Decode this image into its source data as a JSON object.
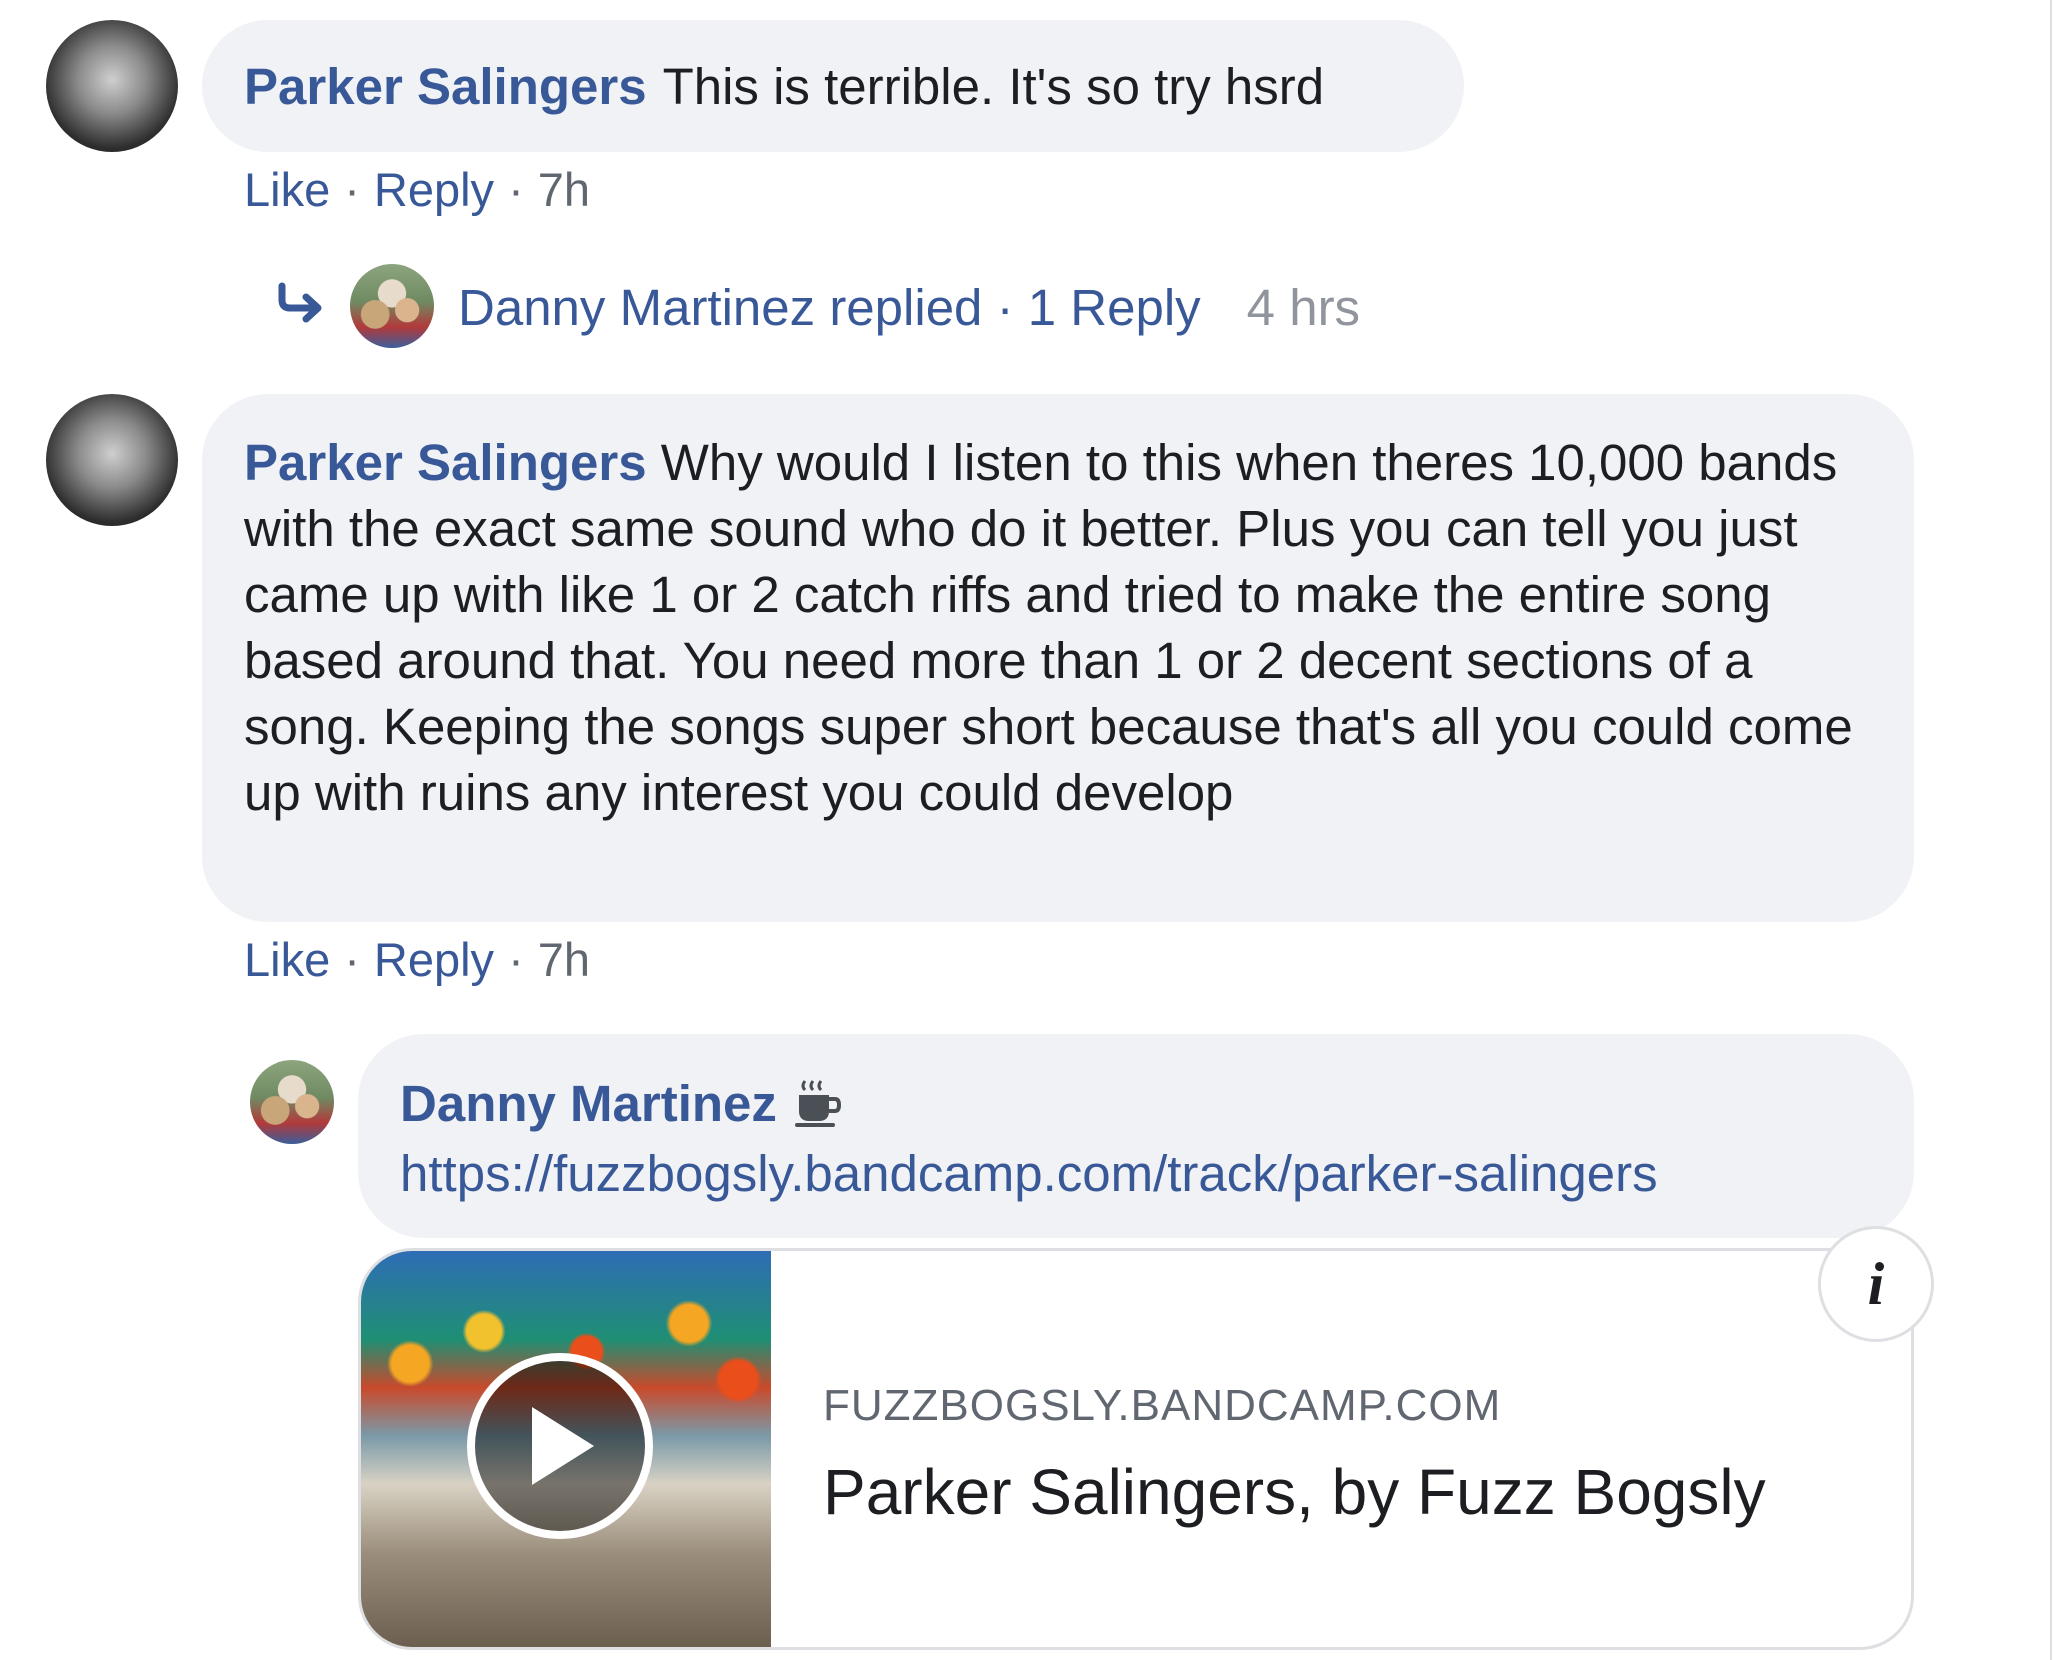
{
  "comments": [
    {
      "author": "Parker Salingers",
      "text": "This is terrible. It's so try hsrd",
      "actions": {
        "like": "Like",
        "reply": "Reply",
        "time": "7h",
        "sep": "·"
      },
      "replies_summary": {
        "text": "Danny Martinez replied · 1 Reply",
        "time": "4 hrs"
      }
    },
    {
      "author": "Parker Salingers",
      "text": "Why would I listen to this when theres 10,000 bands with the exact same sound who do it better. Plus you can tell you just came up with like 1 or 2 catch riffs and tried to make the entire song based around that. You need more than 1 or 2 decent sections of a song. Keeping the songs super short because that's all you could come up with ruins any interest you could develop",
      "actions": {
        "like": "Like",
        "reply": "Reply",
        "time": "7h",
        "sep": "·"
      }
    }
  ],
  "reply": {
    "author": "Danny Martinez",
    "badge_icon": "coffee-cup-icon",
    "link_text": "https://fuzzbogsly.bandcamp.com/track/parker-salingers",
    "preview": {
      "domain": "FUZZBOGSLY.BANDCAMP.COM",
      "title": "Parker Salingers, by Fuzz Bogsly",
      "info_label": "i"
    }
  },
  "colors": {
    "link_blue": "#385898",
    "bubble_gray": "#f0f2f5",
    "meta_gray": "#606770"
  }
}
